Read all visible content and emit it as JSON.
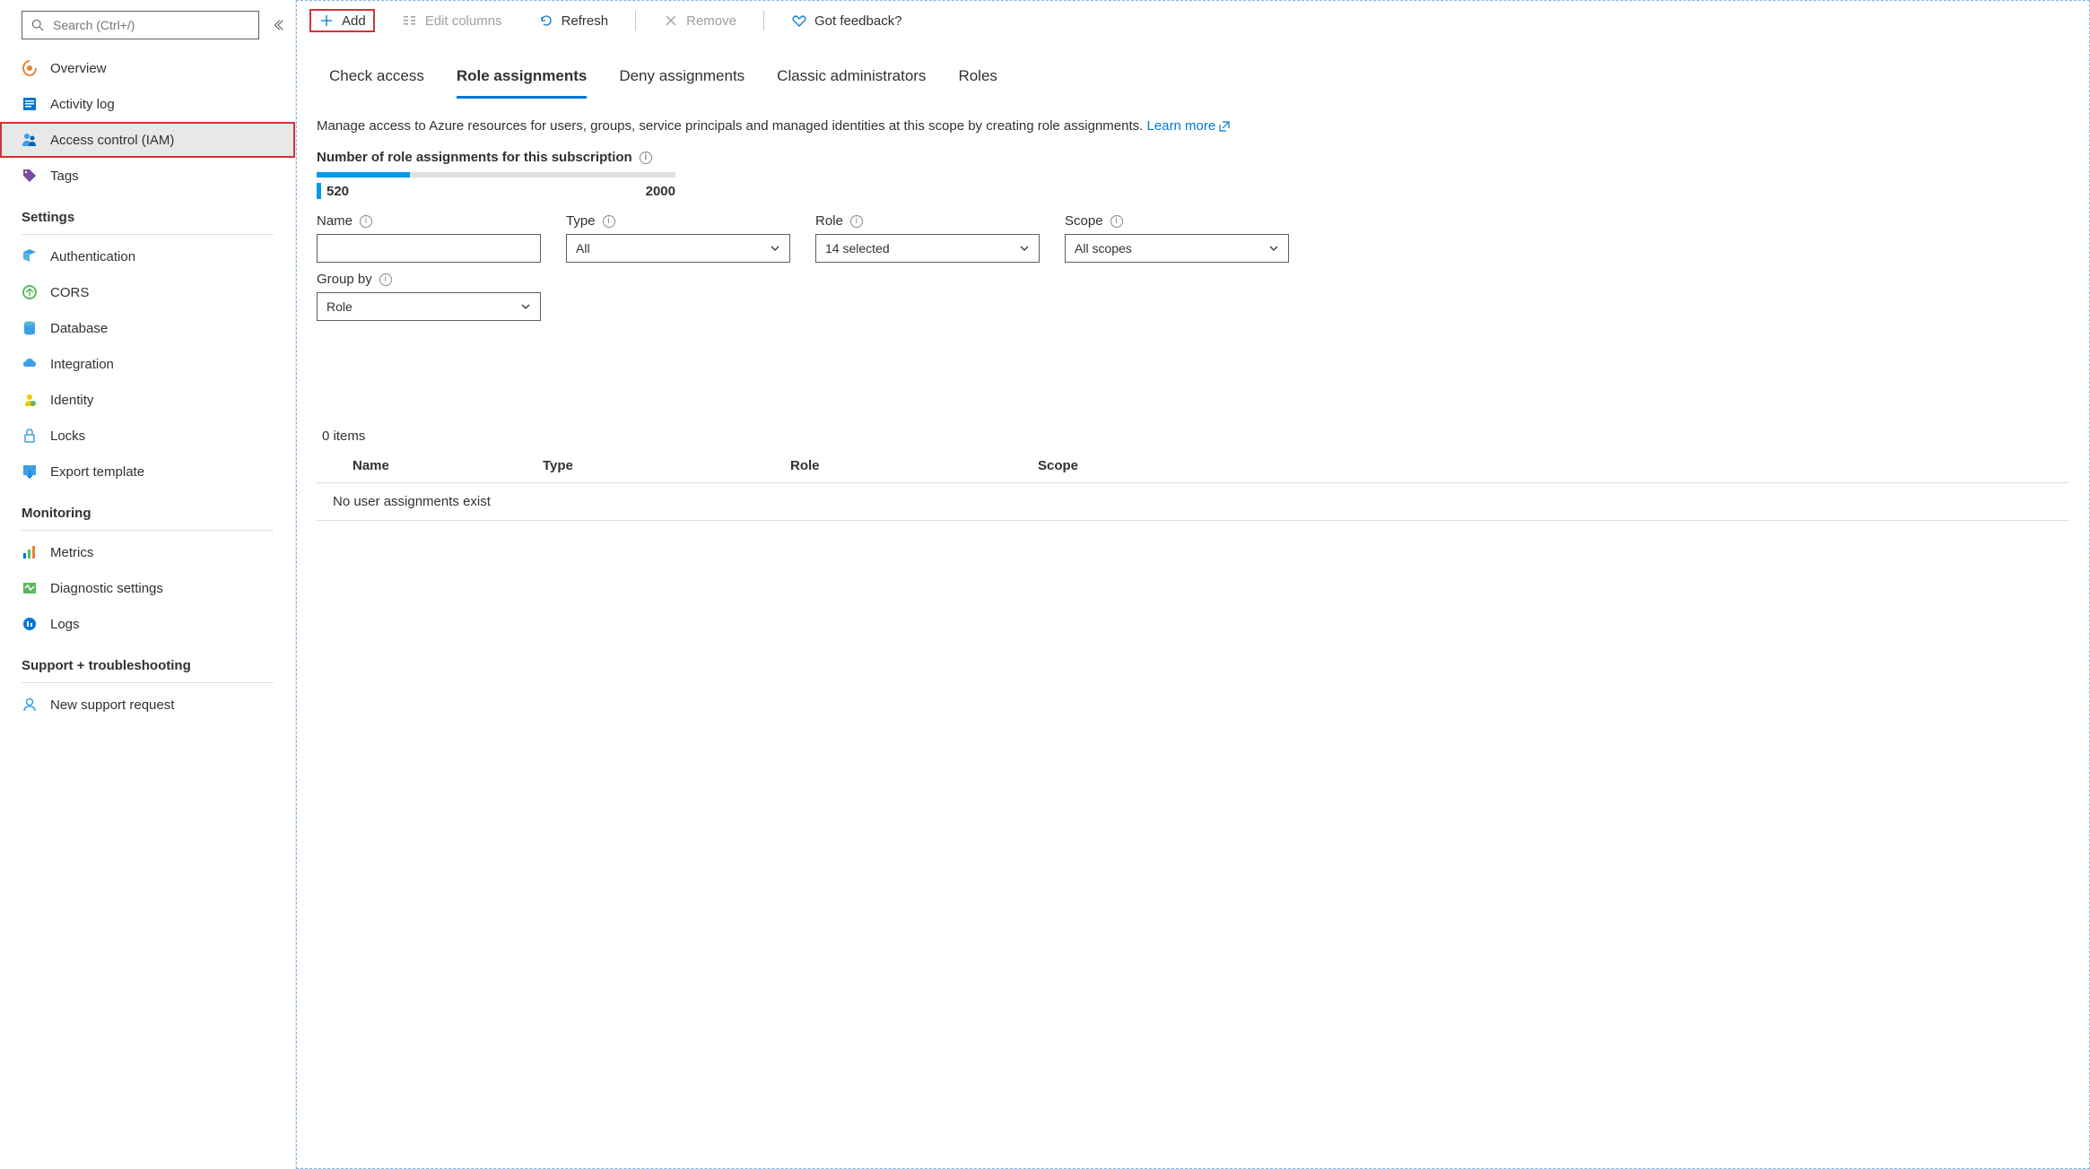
{
  "search": {
    "placeholder": "Search (Ctrl+/)"
  },
  "sidebar": {
    "items": [
      {
        "label": "Overview"
      },
      {
        "label": "Activity log"
      },
      {
        "label": "Access control (IAM)"
      },
      {
        "label": "Tags"
      }
    ],
    "sections": {
      "settings": {
        "title": "Settings",
        "items": [
          {
            "label": "Authentication"
          },
          {
            "label": "CORS"
          },
          {
            "label": "Database"
          },
          {
            "label": "Integration"
          },
          {
            "label": "Identity"
          },
          {
            "label": "Locks"
          },
          {
            "label": "Export template"
          }
        ]
      },
      "monitoring": {
        "title": "Monitoring",
        "items": [
          {
            "label": "Metrics"
          },
          {
            "label": "Diagnostic settings"
          },
          {
            "label": "Logs"
          }
        ]
      },
      "support": {
        "title": "Support + troubleshooting",
        "items": [
          {
            "label": "New support request"
          }
        ]
      }
    }
  },
  "toolbar": {
    "add": "Add",
    "edit_columns": "Edit columns",
    "refresh": "Refresh",
    "remove": "Remove",
    "feedback": "Got feedback?"
  },
  "tabs": {
    "check_access": "Check access",
    "role_assignments": "Role assignments",
    "deny_assignments": "Deny assignments",
    "classic_admins": "Classic administrators",
    "roles": "Roles"
  },
  "description": "Manage access to Azure resources for users, groups, service principals and managed identities at this scope by creating role assignments. ",
  "learn_more": "Learn more",
  "counter": {
    "label": "Number of role assignments for this subscription",
    "current": "520",
    "max": "2000"
  },
  "filters": {
    "name": {
      "label": "Name"
    },
    "type": {
      "label": "Type",
      "value": "All"
    },
    "role": {
      "label": "Role",
      "value": "14 selected"
    },
    "scope": {
      "label": "Scope",
      "value": "All scopes"
    },
    "groupby": {
      "label": "Group by",
      "value": "Role"
    }
  },
  "results": {
    "count": "0 items",
    "columns": {
      "name": "Name",
      "type": "Type",
      "role": "Role",
      "scope": "Scope"
    },
    "empty": "No user assignments exist"
  }
}
